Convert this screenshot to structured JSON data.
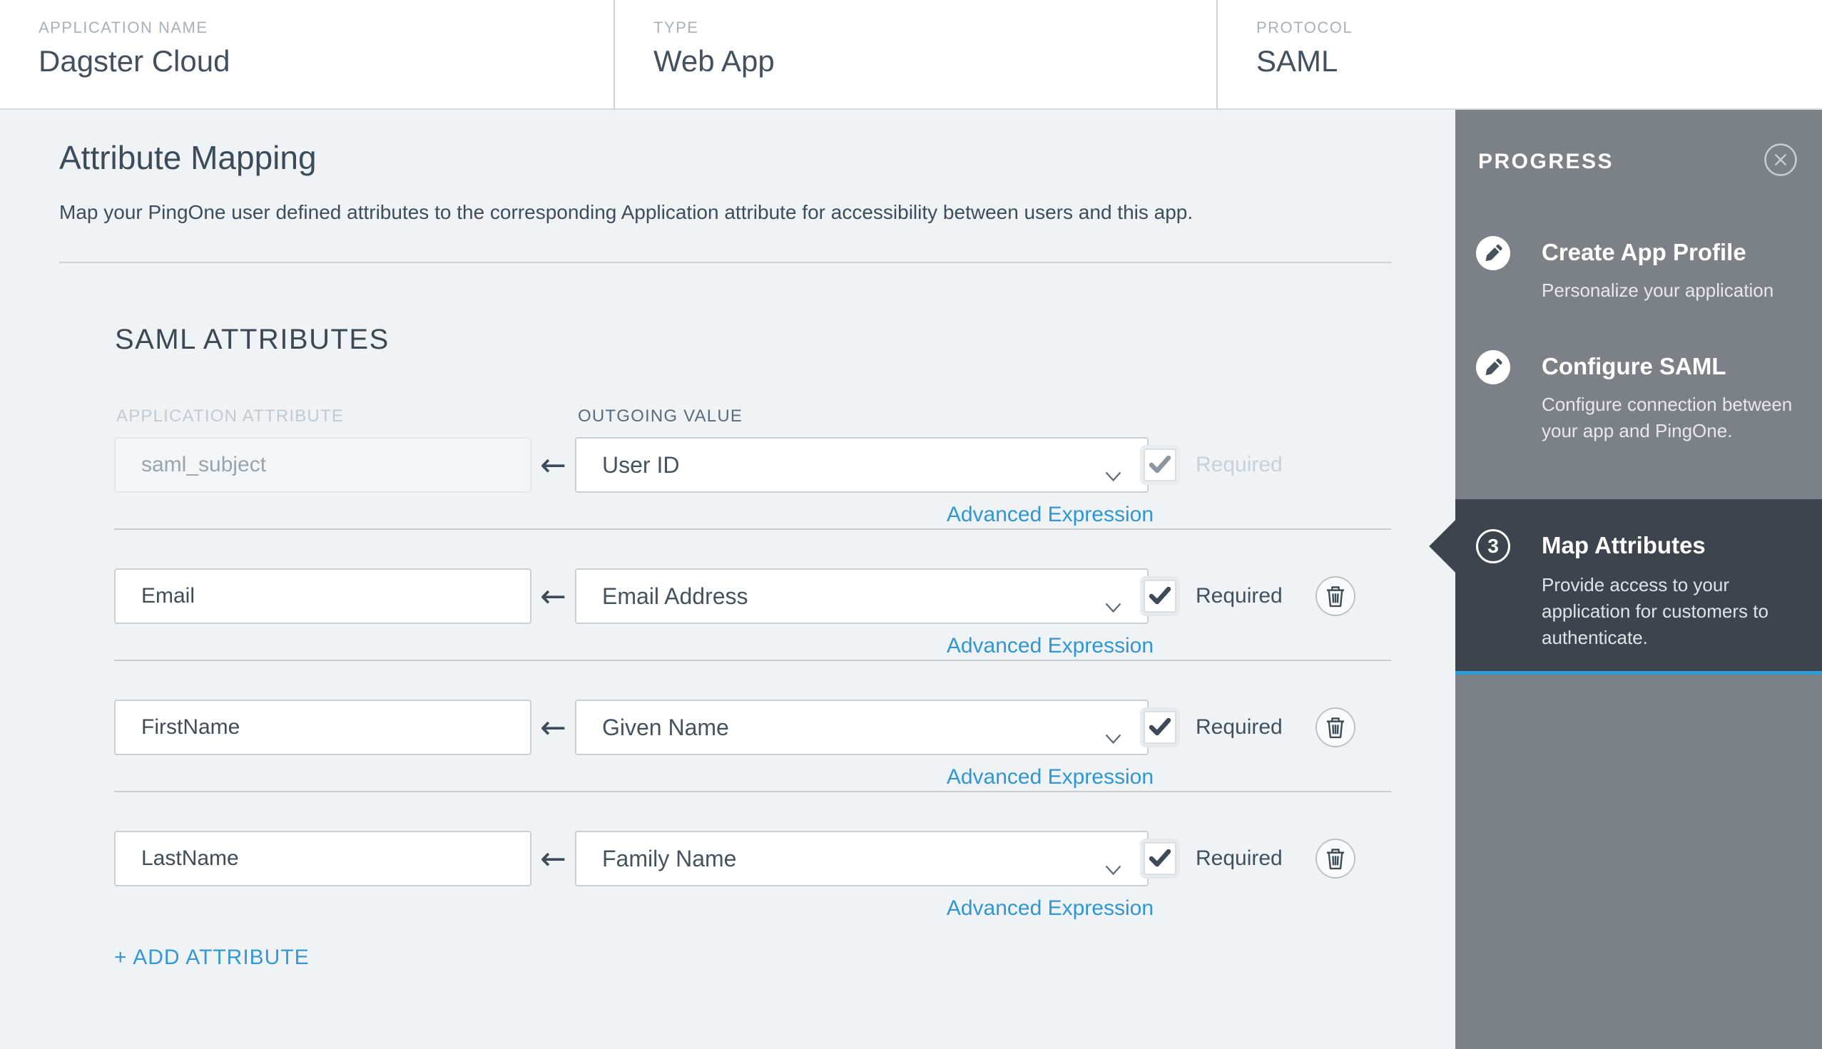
{
  "header": {
    "fields": [
      {
        "label": "APPLICATION NAME",
        "value": "Dagster Cloud"
      },
      {
        "label": "TYPE",
        "value": "Web App"
      },
      {
        "label": "PROTOCOL",
        "value": "SAML"
      }
    ]
  },
  "main": {
    "title": "Attribute Mapping",
    "description": "Map your PingOne user defined attributes to the corresponding Application attribute for accessibility between users and this app.",
    "section_heading": "SAML ATTRIBUTES",
    "columns": {
      "application_attribute": "APPLICATION ATTRIBUTE",
      "outgoing_value": "OUTGOING VALUE"
    },
    "advanced_expression_label": "Advanced Expression",
    "required_label": "Required",
    "add_attribute_label": "+ ADD ATTRIBUTE",
    "rows": [
      {
        "app_attribute": "saml_subject",
        "outgoing_value": "User ID",
        "required_checked": true,
        "disabled": true,
        "deletable": false
      },
      {
        "app_attribute": "Email",
        "outgoing_value": "Email Address",
        "required_checked": true,
        "disabled": false,
        "deletable": true
      },
      {
        "app_attribute": "FirstName",
        "outgoing_value": "Given Name",
        "required_checked": true,
        "disabled": false,
        "deletable": true
      },
      {
        "app_attribute": "LastName",
        "outgoing_value": "Family Name",
        "required_checked": true,
        "disabled": false,
        "deletable": true
      }
    ]
  },
  "progress": {
    "heading": "PROGRESS",
    "close_icon": "close-icon",
    "steps": [
      {
        "icon": "pencil-icon",
        "title": "Create App Profile",
        "subtitle": "Personalize your application",
        "active": false
      },
      {
        "icon": "pencil-icon",
        "title": "Configure SAML",
        "subtitle": "Configure connection between your app and PingOne.",
        "active": false
      },
      {
        "number": "3",
        "title": "Map Attributes",
        "subtitle": "Provide access to your application for customers to authenticate.",
        "active": true
      }
    ]
  },
  "colors": {
    "link_blue": "#3096d4",
    "accent_blue": "#2d9dd8",
    "panel_gray": "#7c8187",
    "active_dark": "#3d444d",
    "content_bg": "#eff3f6",
    "text_slate": "#3d4a57"
  }
}
